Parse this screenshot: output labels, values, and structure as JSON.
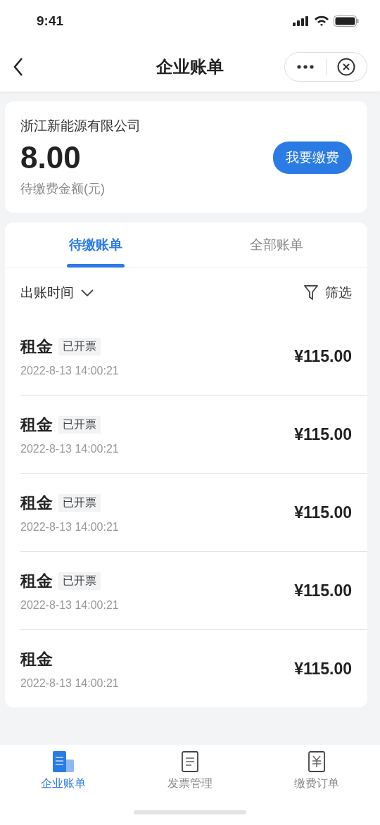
{
  "status_bar": {
    "time": "9:41"
  },
  "nav": {
    "title": "企业账单"
  },
  "summary": {
    "company": "浙江新能源有限公司",
    "amount": "8.00",
    "amount_label": "待缴费金额(元)",
    "pay_button": "我要缴费"
  },
  "tabs": [
    {
      "label": "待缴账单",
      "selected": true
    },
    {
      "label": "全部账单",
      "selected": false
    }
  ],
  "filters": {
    "sort": "出账时间",
    "filter": "筛选"
  },
  "bills": [
    {
      "name": "租金",
      "tag": "已开票",
      "time": "2022-8-13 14:00:21",
      "amount": "¥115.00"
    },
    {
      "name": "租金",
      "tag": "已开票",
      "time": "2022-8-13 14:00:21",
      "amount": "¥115.00"
    },
    {
      "name": "租金",
      "tag": "已开票",
      "time": "2022-8-13 14:00:21",
      "amount": "¥115.00"
    },
    {
      "name": "租金",
      "tag": "已开票",
      "time": "2022-8-13 14:00:21",
      "amount": "¥115.00"
    },
    {
      "name": "租金",
      "time": "2022-8-13 14:00:21",
      "amount": "¥115.00"
    }
  ],
  "tab_bar": [
    {
      "kind": "bills",
      "label": "企业账单",
      "selected": true
    },
    {
      "kind": "invoice",
      "label": "发票管理",
      "selected": false
    },
    {
      "kind": "orders",
      "label": "缴费订单",
      "selected": false
    }
  ]
}
